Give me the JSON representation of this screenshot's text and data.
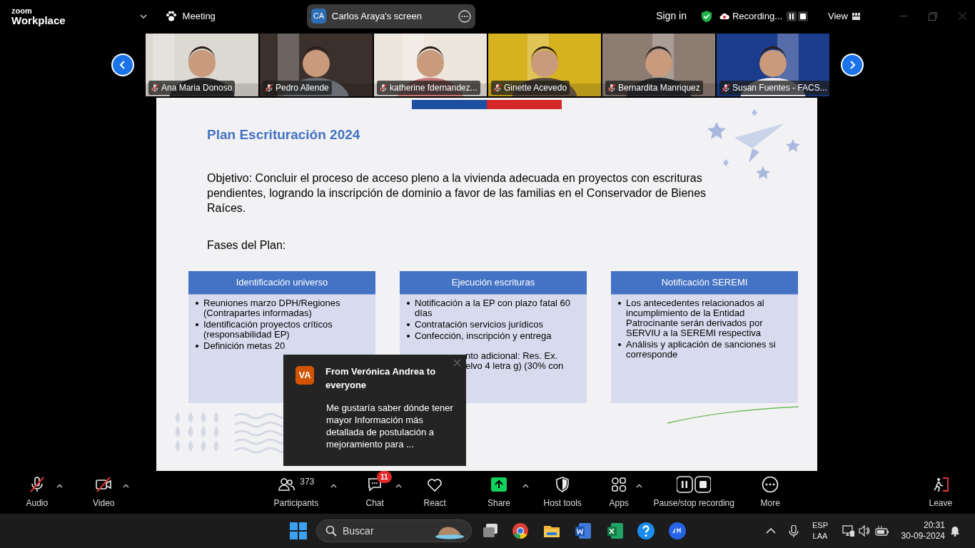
{
  "top_bar": {
    "logo_top": "zoom",
    "logo_bottom": "Workplace",
    "meeting": "Meeting",
    "share_initials": "CA",
    "share_title": "Carlos Araya's screen",
    "sign_in": "Sign in",
    "recording": "Recording...",
    "view": "View"
  },
  "participants": [
    {
      "name": "Ana Maria Donoso",
      "muted": true
    },
    {
      "name": "Pedro Allende",
      "muted": true
    },
    {
      "name": "katherine fdernandez...",
      "muted": true
    },
    {
      "name": "Ginette Acevedo",
      "muted": true
    },
    {
      "name": "Bernardita Manriquez",
      "muted": true
    },
    {
      "name": "Susan Fuentes - FACS...",
      "muted": true
    }
  ],
  "slide": {
    "title": "Plan Escrituración 2024",
    "objective": "Objetivo: Concluir el proceso de acceso pleno a la vivienda adecuada en proyectos con escrituras pendientes, logrando la inscripción de dominio a favor de las familias en el Conservador de Bienes Raíces.",
    "phases_label": "Fases del Plan:",
    "columns": [
      {
        "heading": "Identificación universo",
        "bullets": [
          "Reuniones marzo DPH/Regiones (Contrapartes informadas)",
          "Identificación proyectos críticos (responsabilidad EP)",
          "Definición metas 20"
        ]
      },
      {
        "heading": "Ejecución escrituras",
        "bullets": [
          "Notificación a la EP con plazo fatal 60 días",
          "Contratación servicios jurídicos",
          "Confección, inscripción y entrega"
        ],
        "fragments": [
          "nto adicional: Res. Ex.",
          "elvo 4 letra g) (30% con"
        ]
      },
      {
        "heading": "Notificación SEREMI",
        "bullets": [
          "Los antecedentes relacionados al incumplimiento de la Entidad Patrocinante serán derivados por SERVIU a la SEREMI respectiva",
          "Análisis y aplicación de sanciones si corresponde"
        ]
      }
    ]
  },
  "chat_popup": {
    "initials": "VA",
    "sender": "From Verónica Andrea to everyone",
    "message": "Me gustaría saber dónde tener mayor Información más detallada de postulación a mejoramiento para ..."
  },
  "toolbar": [
    {
      "kind": "audio",
      "label": "Audio",
      "off": true,
      "caret": true
    },
    {
      "kind": "video",
      "label": "Video",
      "off": true,
      "caret": true
    },
    {
      "kind": "participants",
      "label": "Participants",
      "count": "373",
      "caret": true
    },
    {
      "kind": "chat",
      "label": "Chat",
      "badge": "11",
      "caret": true
    },
    {
      "kind": "react",
      "label": "React",
      "caret": false
    },
    {
      "kind": "share",
      "label": "Share",
      "caret": true
    },
    {
      "kind": "host",
      "label": "Host tools",
      "caret": false
    },
    {
      "kind": "apps",
      "label": "Apps",
      "caret": true
    },
    {
      "kind": "record",
      "label": "Pause/stop recording",
      "caret": false
    },
    {
      "kind": "more",
      "label": "More",
      "caret": false
    },
    {
      "kind": "leave",
      "label": "Leave",
      "caret": false
    }
  ],
  "taskbar": {
    "search": "Buscar",
    "lang_top": "ESP",
    "lang_bottom": "LAA",
    "time": "20:31",
    "date": "30-09-2024"
  }
}
